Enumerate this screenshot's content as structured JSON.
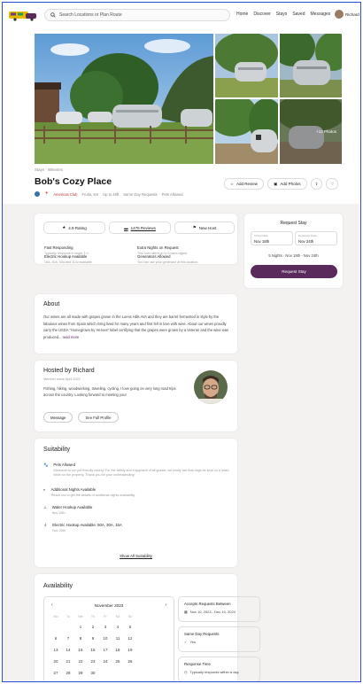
{
  "header": {
    "search_placeholder": "Search Locations or Plan Route",
    "nav": [
      "Home",
      "Discover",
      "Stays",
      "Saved",
      "Messages"
    ],
    "user_name": "Richard"
  },
  "gallery": {
    "more_photos": "+12 Photos"
  },
  "breadcrumb": "Stays · Wineries",
  "listing": {
    "title": "Bob's Cozy Place",
    "club": "Americas Club",
    "location": "Fruita, KS",
    "length": "Up to 45ft",
    "same_day": "Same Day Requests",
    "pets": "Pets Allowed"
  },
  "actions": {
    "add_review": "Add Review",
    "add_photos": "Add Photos"
  },
  "rating_bar": {
    "rating": "4.9 Rating",
    "reviews": "1475 Reviews",
    "host": "New Host"
  },
  "features": [
    {
      "title": "Fast Responding",
      "desc": "Typically responds in under 1 h."
    },
    {
      "title": "Extra Nights on Request",
      "desc": "This host offers up to 5 extra nights."
    },
    {
      "title": "Electric Hookup Available",
      "desc": "15A, 30A, 50A and 110v available."
    },
    {
      "title": "Generators Allowed",
      "desc": "You can use your generator at this location."
    }
  ],
  "request": {
    "title": "Request Stay",
    "arrival_label": "Arrival Date",
    "arrival": "Nov 18th",
    "departure_label": "Departure Date",
    "departure": "Nov 24th",
    "summary": "5 Nights · Nov 19th - Nov 24th",
    "button": "Request Stay"
  },
  "about": {
    "title": "About",
    "text": "Our wines are all made with grapes grown in the Loess Hills AVA and they are barrel fermented in style by the fabulous wines from Spain which Greg lived for many years and first fell in love with wine. About our wines proudly carry the USDA \"Homegrown by Heroes\" label certifying that the grapes were grown by a Veteran and the wine was produced...",
    "read_more": "read more"
  },
  "host": {
    "title": "Hosted by Richard",
    "since": "Member since April 2022",
    "bio": "Fishing, hiking, woodworking, traveling, cycling. I love going on very long road trips across the country. Looking forward to meeting you!",
    "message": "Message",
    "profile": "See Full Profile"
  },
  "suitability": {
    "title": "Suitability",
    "items": [
      {
        "title": "Pets Allowed",
        "desc": "Welcome to our pet friendly winery! For the safety and enjoyment of all guests, we kindly ask that dogs be kept on a leash while on the property. Thank you for your understanding!"
      },
      {
        "title": "Additional Nights Available",
        "desc": "Reach out to get the details of additional nights availability"
      },
      {
        "title": "Water Hookup Available",
        "desc": "Nov 20th"
      },
      {
        "title": "Electric Hookup Available: 50A, 30A, 15A",
        "desc": "Nov 20th"
      }
    ],
    "show_all": "Show All Suitability"
  },
  "availability": {
    "title": "Availability",
    "month": "November 2023",
    "weekdays": [
      "Mo",
      "Tu",
      "We",
      "Th",
      "Fr",
      "Sa",
      "Su"
    ],
    "weeks": [
      [
        "",
        "",
        "1",
        "2",
        "3",
        "4",
        "5"
      ],
      [
        "6",
        "7",
        "8",
        "9",
        "10",
        "11",
        "12"
      ],
      [
        "13",
        "14",
        "15",
        "16",
        "17",
        "18",
        "19"
      ],
      [
        "20",
        "21",
        "22",
        "23",
        "24",
        "25",
        "26"
      ],
      [
        "27",
        "28",
        "29",
        "30",
        "",
        "",
        ""
      ]
    ],
    "accepts_label": "Accepts Requests Between",
    "accepts_value": "Nov 10, 2023 - Dec 10, 2024",
    "sameday_label": "Same Day Requests",
    "sameday_value": "Yes",
    "response_label": "Response Time",
    "response_value": "Typically responds within a day"
  },
  "colors": {
    "accent": "#5a2a5c",
    "frame": "#2a4fd6"
  }
}
